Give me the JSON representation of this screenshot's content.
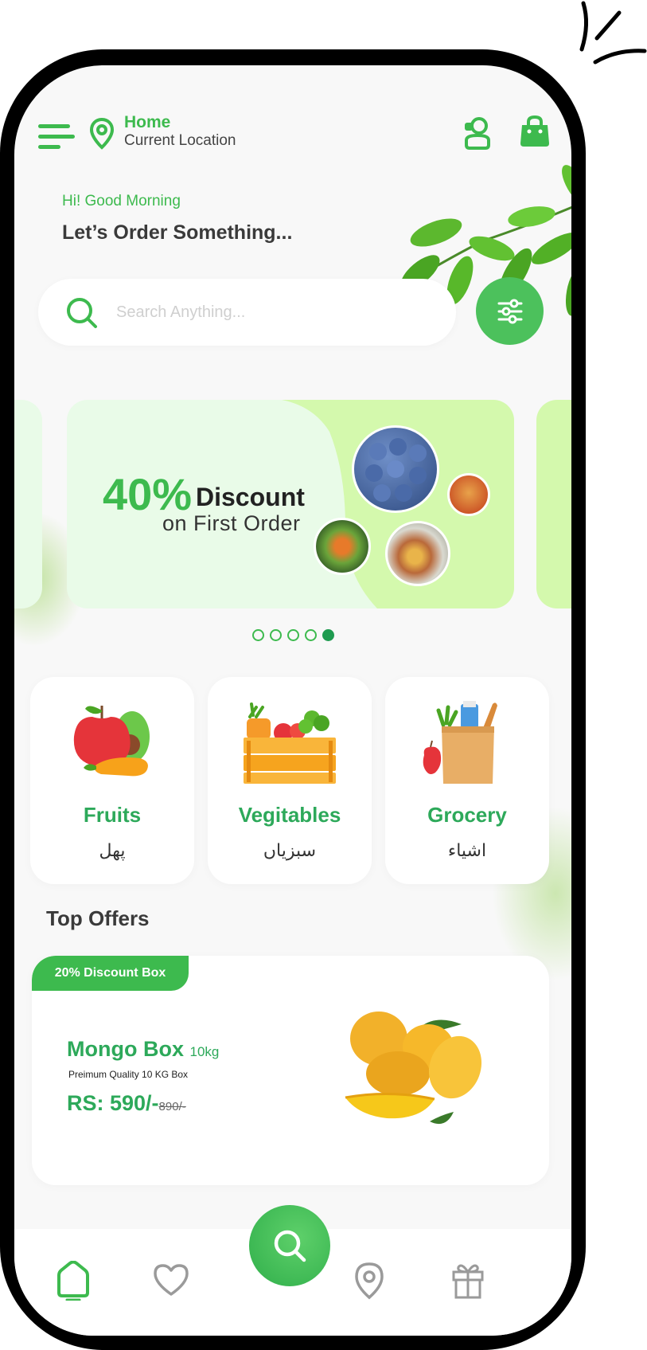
{
  "header": {
    "location_title": "Home",
    "location_subtitle": "Current Location"
  },
  "greeting": "Hi! Good Morning",
  "headline": "Let’s Order Something...",
  "search": {
    "placeholder": "Search Anything..."
  },
  "banner": {
    "discount_percent": "40%",
    "discount_word": "Discount",
    "subtitle": "on First Order"
  },
  "carousel": {
    "page_count": 5,
    "active_index": 4
  },
  "categories": [
    {
      "name": "Fruits",
      "urdu": "پھل",
      "icon": "fruits-icon"
    },
    {
      "name": "Vegitables",
      "urdu": "سبزیاں",
      "icon": "vegetables-crate-icon"
    },
    {
      "name": "Grocery",
      "urdu": "اشیاء",
      "icon": "grocery-bag-icon"
    }
  ],
  "top_offers": {
    "title": "Top Offers",
    "offer": {
      "badge": "20% Discount Box",
      "name": "Mongo Box",
      "weight": "10kg",
      "description": "Preimum Quality 10 KG Box",
      "price": "RS: 590/-",
      "old_price": "890/-"
    }
  },
  "nav": {
    "items": [
      "home-icon",
      "heart-icon",
      "search-icon",
      "location-icon",
      "gift-icon"
    ],
    "active": "home-icon"
  },
  "colors": {
    "accent": "#3dba4e",
    "accent_dark": "#2da95a",
    "banner_light": "#e9fbe8",
    "banner_lime": "#d4f9ad"
  }
}
